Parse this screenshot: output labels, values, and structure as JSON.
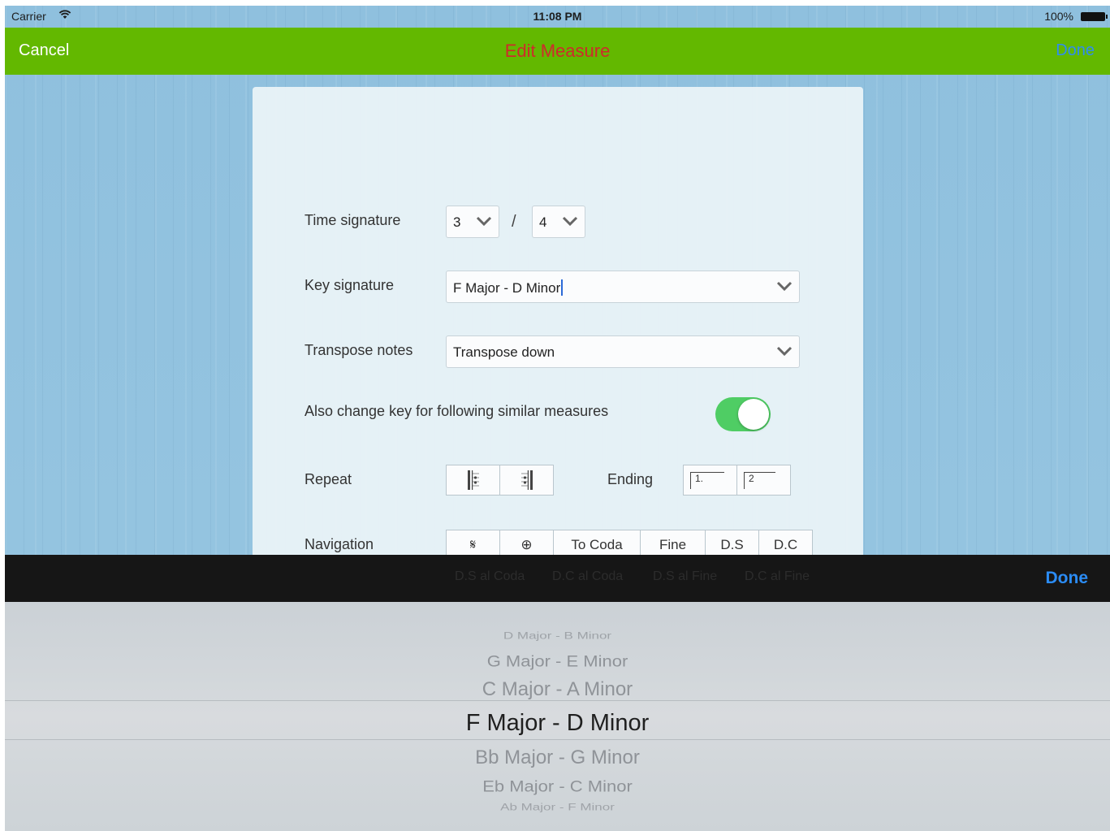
{
  "status_bar": {
    "carrier": "Carrier",
    "time": "11:08 PM",
    "battery": "100%"
  },
  "nav_bar": {
    "cancel": "Cancel",
    "title": "Edit Measure",
    "done": "Done",
    "colors": {
      "bar": "#63b800",
      "title": "#ce2b2b",
      "done": "#2f8df3"
    }
  },
  "form": {
    "time_signature": {
      "label": "Time signature",
      "numerator": "3",
      "separator": "/",
      "denominator": "4"
    },
    "key_signature": {
      "label": "Key signature",
      "value": "F Major - D Minor"
    },
    "transpose": {
      "label": "Transpose notes",
      "value": "Transpose down"
    },
    "also_change": {
      "label": "Also change key for following similar measures",
      "on": true
    },
    "repeat": {
      "label": "Repeat",
      "buttons": [
        "repeat-start",
        "repeat-end"
      ]
    },
    "ending": {
      "label": "Ending",
      "buttons": [
        "1.",
        "2"
      ]
    },
    "navigation": {
      "label": "Navigation",
      "buttons": [
        "𝄋",
        "⊕",
        "To Coda",
        "Fine",
        "D.S",
        "D.C"
      ],
      "second_row": [
        "D.S al Coda",
        "D.C al Coda",
        "D.S al Fine",
        "D.C al Fine"
      ]
    }
  },
  "accessory": {
    "done": "Done"
  },
  "picker": {
    "options": [
      "D Major - B Minor",
      "G Major - E Minor",
      "C Major - A Minor",
      "F Major - D Minor",
      "Bb Major - G Minor",
      "Eb Major - C Minor",
      "Ab Major - F Minor"
    ],
    "selected": "F Major - D Minor"
  }
}
